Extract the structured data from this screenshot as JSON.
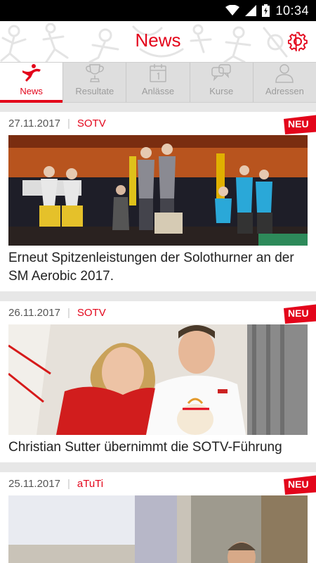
{
  "status_bar": {
    "time": "10:34",
    "icons": [
      "wifi-icon",
      "signal-icon",
      "battery-charging-icon"
    ]
  },
  "header": {
    "title": "News",
    "settings_icon": "gear-icon"
  },
  "tabs": [
    {
      "label": "News",
      "icon": "athlete-icon",
      "active": true
    },
    {
      "label": "Resultate",
      "icon": "trophy-icon",
      "active": false
    },
    {
      "label": "Anlässe",
      "icon": "calendar-icon",
      "active": false
    },
    {
      "label": "Kurse",
      "icon": "chat-icon",
      "active": false
    },
    {
      "label": "Adressen",
      "icon": "person-icon",
      "active": false
    }
  ],
  "news": [
    {
      "date": "27.11.2017",
      "category": "SOTV",
      "badge": "NEU",
      "title": "Erneut Spitzenleistungen der Solothurner an der SM Aerobic 2017."
    },
    {
      "date": "26.11.2017",
      "category": "SOTV",
      "badge": "NEU",
      "title": "Christian Sutter übernimmt die SOTV-Führung"
    },
    {
      "date": "25.11.2017",
      "category": "aTuTi",
      "badge": "NEU",
      "title": ""
    }
  ],
  "colors": {
    "accent": "#e3051b",
    "tab_bar": "#dedede",
    "background": "#e7e7e7"
  }
}
